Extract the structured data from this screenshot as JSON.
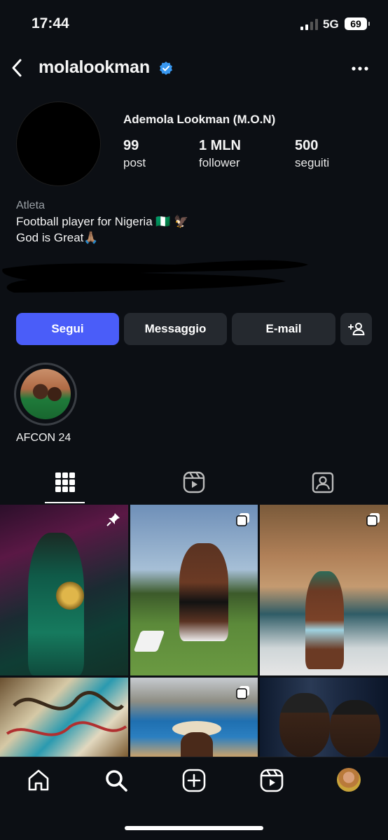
{
  "status_bar": {
    "time": "17:44",
    "network": "5G",
    "battery": "69"
  },
  "header": {
    "username": "molalookman",
    "verified": true,
    "icons": [
      "back-arrow-icon",
      "verified-badge-icon",
      "more-icon"
    ]
  },
  "profile": {
    "full_name": "Ademola Lookman (M.O.N)",
    "stats": [
      {
        "value": "99",
        "label": "post"
      },
      {
        "value": "1 MLN",
        "label": "follower"
      },
      {
        "value": "500",
        "label": "seguiti"
      }
    ],
    "category": "Atleta",
    "bio_line1": "Football player for Nigeria 🇳🇬 🦅",
    "bio_line2": "God is Great🙏🏽"
  },
  "actions": {
    "follow_label": "Segui",
    "message_label": "Messaggio",
    "email_label": "E-mail",
    "add_icon": "add-person-icon"
  },
  "highlights": [
    {
      "label": "AFCON 24"
    }
  ],
  "tabs": [
    "grid-icon",
    "reels-icon",
    "tagged-icon"
  ],
  "posts_badges": [
    "pin-icon",
    "carousel-icon",
    "carousel-icon",
    "",
    "carousel-icon",
    ""
  ],
  "bottom_nav": [
    "home-icon",
    "search-icon",
    "create-icon",
    "reels-icon",
    "profile-avatar"
  ],
  "colors": {
    "background": "#0c0f14",
    "accent": "#4a5df9",
    "verified": "#3897f0",
    "button": "#25292f"
  }
}
